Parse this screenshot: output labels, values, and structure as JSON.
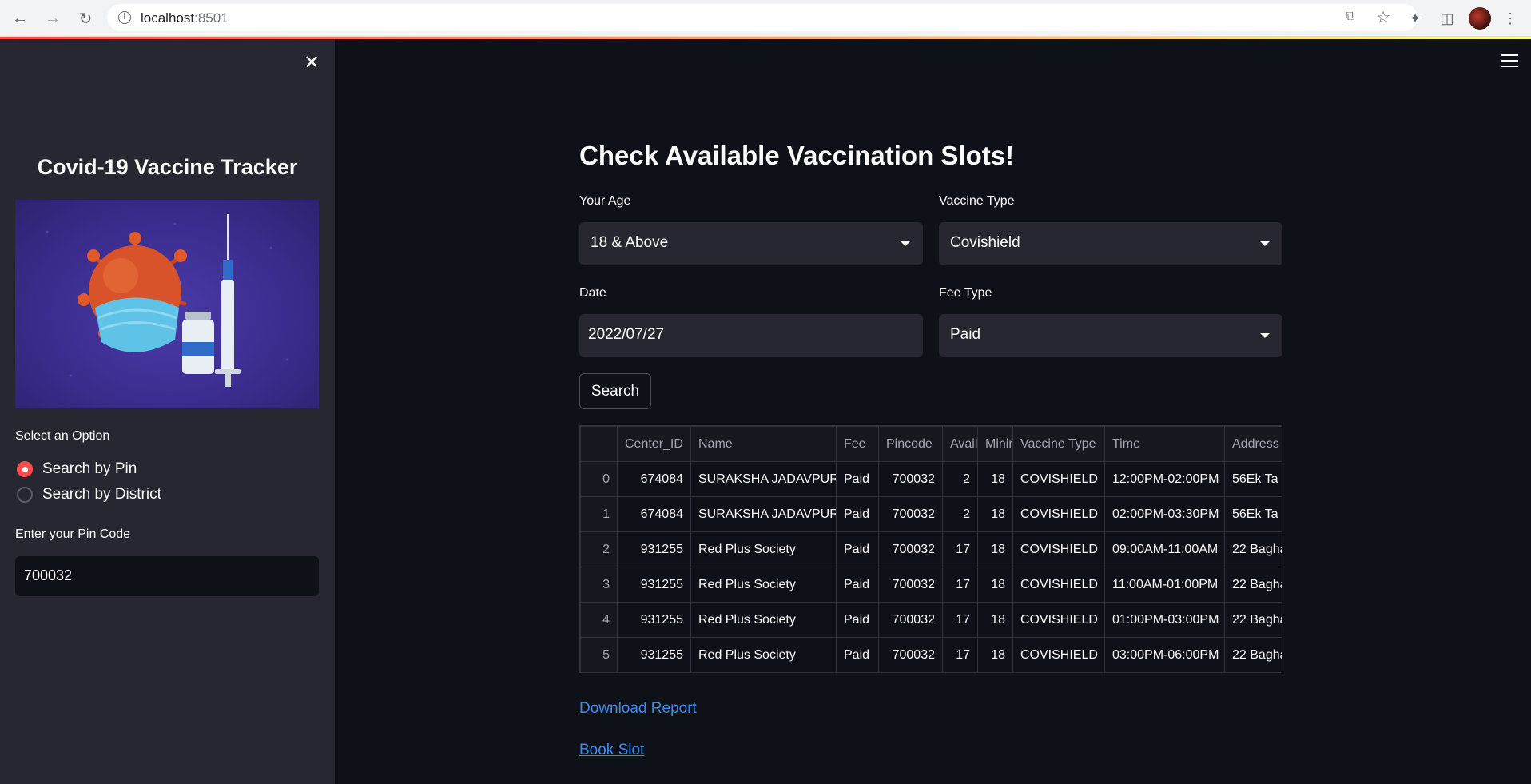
{
  "browser": {
    "url_host": "localhost",
    "url_port": ":8501"
  },
  "sidebar": {
    "title": "Covid-19 Vaccine Tracker",
    "option_label": "Select an Option",
    "options": [
      "Search by Pin",
      "Search by District"
    ],
    "selected_option": "Search by Pin",
    "pin_label": "Enter your Pin Code",
    "pin_value": "700032"
  },
  "main": {
    "title": "Check Available Vaccination Slots!",
    "age_label": "Your Age",
    "age_value": "18 & Above",
    "vaccine_label": "Vaccine Type",
    "vaccine_value": "Covishield",
    "date_label": "Date",
    "date_value": "2022/07/27",
    "fee_label": "Fee Type",
    "fee_value": "Paid",
    "search_button": "Search",
    "download_link": "Download Report",
    "book_link": "Book Slot"
  },
  "table": {
    "columns": [
      "",
      "Center_ID",
      "Name",
      "Fee",
      "Pincode",
      "Avail",
      "Minir",
      "Vaccine Type",
      "Time",
      "Address"
    ],
    "rows": [
      [
        "0",
        "674084",
        "SURAKSHA JADAVPUR",
        "Paid",
        "700032",
        "2",
        "18",
        "COVISHIELD",
        "12:00PM-02:00PM",
        "56Ek Ta"
      ],
      [
        "1",
        "674084",
        "SURAKSHA JADAVPUR",
        "Paid",
        "700032",
        "2",
        "18",
        "COVISHIELD",
        "02:00PM-03:30PM",
        "56Ek Ta"
      ],
      [
        "2",
        "931255",
        "Red Plus Society",
        "Paid",
        "700032",
        "17",
        "18",
        "COVISHIELD",
        "09:00AM-11:00AM",
        "22 Bagha"
      ],
      [
        "3",
        "931255",
        "Red Plus Society",
        "Paid",
        "700032",
        "17",
        "18",
        "COVISHIELD",
        "11:00AM-01:00PM",
        "22 Bagha"
      ],
      [
        "4",
        "931255",
        "Red Plus Society",
        "Paid",
        "700032",
        "17",
        "18",
        "COVISHIELD",
        "01:00PM-03:00PM",
        "22 Bagha"
      ],
      [
        "5",
        "931255",
        "Red Plus Society",
        "Paid",
        "700032",
        "17",
        "18",
        "COVISHIELD",
        "03:00PM-06:00PM",
        "22 Bagha"
      ]
    ]
  },
  "colors": {
    "accent": "#ff4b4b",
    "link": "#3a8cf5",
    "sidebar_bg": "#262730",
    "main_bg": "#0e1117"
  }
}
